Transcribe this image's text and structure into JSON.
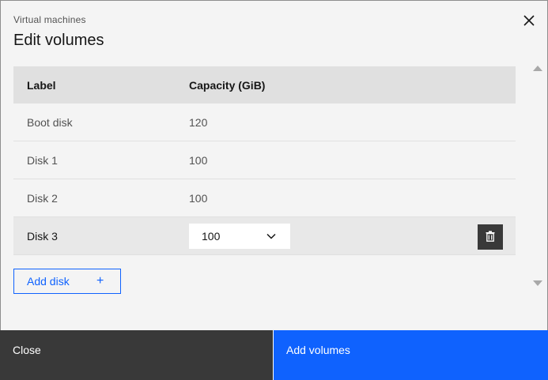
{
  "modal": {
    "label": "Virtual machines",
    "title": "Edit volumes",
    "close_icon": "close-icon"
  },
  "table": {
    "headers": [
      "Label",
      "Capacity (GiB)"
    ],
    "rows": [
      {
        "label": "Boot disk",
        "capacity": "120"
      },
      {
        "label": "Disk 1",
        "capacity": "100"
      },
      {
        "label": "Disk 2",
        "capacity": "100"
      },
      {
        "label": "Disk 3",
        "capacity": "100",
        "editable": true
      }
    ],
    "delete_icon": "trash-icon"
  },
  "add_disk": {
    "label": "Add disk",
    "icon": "+"
  },
  "footer": {
    "secondary_label": "Close",
    "primary_label": "Add volumes"
  },
  "colors": {
    "primary": "#0f62fe",
    "secondary": "#393939",
    "background": "#f4f4f4",
    "header": "#e0e0e0"
  }
}
